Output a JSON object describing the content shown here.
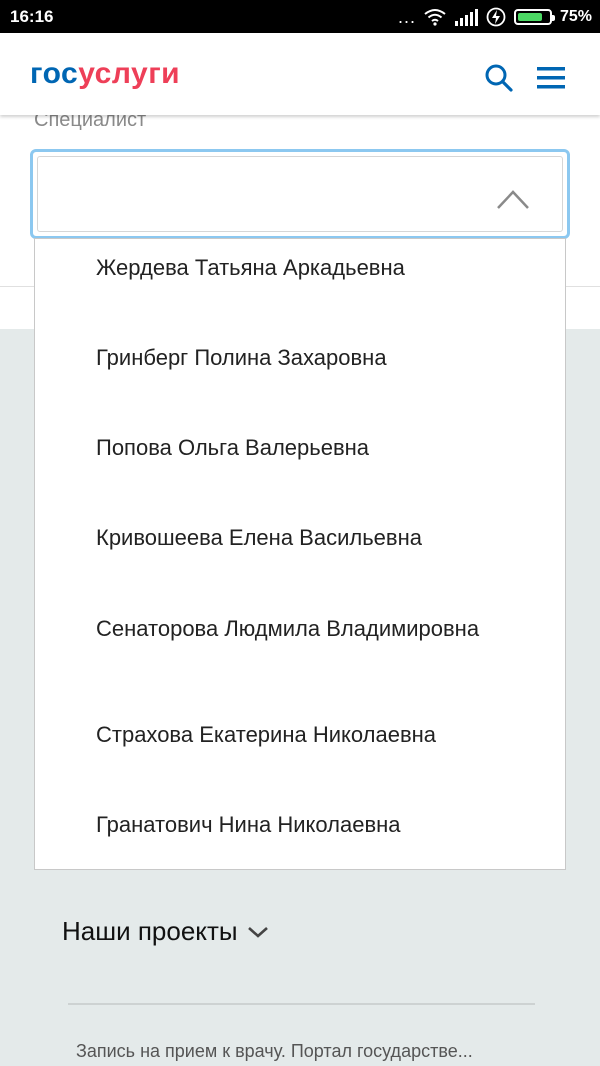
{
  "status_bar": {
    "time": "16:16",
    "dots": "...",
    "battery_percent": "75%",
    "battery_level": 0.75,
    "icons": [
      "wifi-icon",
      "signal-icon",
      "charging-icon",
      "battery-icon"
    ]
  },
  "header": {
    "logo_part1": "гос",
    "logo_part2": "услуги",
    "search_icon": "search-icon",
    "menu_icon": "hamburger-menu-icon"
  },
  "colors": {
    "brand_blue": "#0066b3",
    "brand_red": "#ee3f58",
    "focus_border": "#8cc8f0",
    "page_bg": "#e4eaea"
  },
  "form": {
    "field_label": "Специалист",
    "select_value": ""
  },
  "dropdown": {
    "options": [
      "Жердева Татьяна Аркадьевна",
      "Гринберг Полина Захаровна",
      "Попова Ольга Валерьевна",
      "Кривошеева Елена Васильевна",
      "Сенаторова Людмила Владимировна",
      "Страхова Екатерина Николаевна",
      "Гранатович Нина Николаевна"
    ]
  },
  "footer": {
    "projects_label": "Наши проекты",
    "page_title": "Запись на прием к врачу. Портал государстве..."
  }
}
